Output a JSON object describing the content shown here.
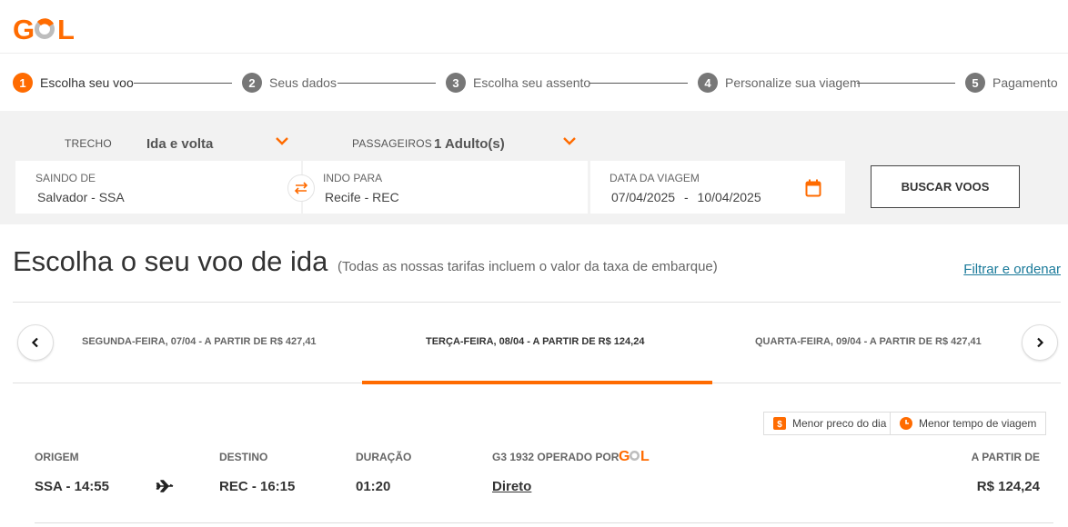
{
  "brand": {
    "name": "GOL",
    "accent": "#ff6b00",
    "logo_icon": "gol-logo"
  },
  "stepper": [
    {
      "num": "1",
      "label": "Escolha seu voo",
      "active": true
    },
    {
      "num": "2",
      "label": "Seus dados"
    },
    {
      "num": "3",
      "label": "Escolha seu assento"
    },
    {
      "num": "4",
      "label": "Personalize sua viagem"
    },
    {
      "num": "5",
      "label": "Pagamento"
    }
  ],
  "search": {
    "trecho_label": "TRECHO",
    "trecho_value": "Ida e volta",
    "passageiros_label": "PASSAGEIROS",
    "passageiros_value": "1 Adulto(s)",
    "origin_label": "SAINDO DE",
    "origin_value": "Salvador - SSA",
    "dest_label": "INDO PARA",
    "dest_value": "Recife - REC",
    "date_label": "DATA DA VIAGEM",
    "date_out": "07/04/2025",
    "date_sep": "-",
    "date_back": "10/04/2025",
    "button": "BUSCAR VOOS"
  },
  "results": {
    "title": "Escolha o seu voo de ida",
    "subtitle": "(Todas as nossas tarifas incluem o valor da taxa de embarque)",
    "filter_link": "Filtrar e ordenar"
  },
  "date_tabs": [
    {
      "label": "SEGUNDA-FEIRA, 07/04 - A PARTIR DE R$ 427,41"
    },
    {
      "label": "TERÇA-FEIRA, 08/04 - A PARTIR DE R$ 124,24",
      "selected": true
    },
    {
      "label": "QUARTA-FEIRA, 09/04 - A PARTIR DE R$ 427,41"
    }
  ],
  "badges": {
    "cheapest": "Menor preco do dia",
    "fastest": "Menor tempo de viagem"
  },
  "flight": {
    "origem_label": "ORIGEM",
    "origem_value": "SSA - 14:55",
    "destino_label": "DESTINO",
    "destino_value": "REC - 16:15",
    "duracao_label": "DURAÇÃO",
    "duracao_value": "01:20",
    "operator_label": "G3 1932 OPERADO POR",
    "stops_value": "Direto",
    "price_label": "A PARTIR DE",
    "price_value": "R$ 124,24"
  }
}
